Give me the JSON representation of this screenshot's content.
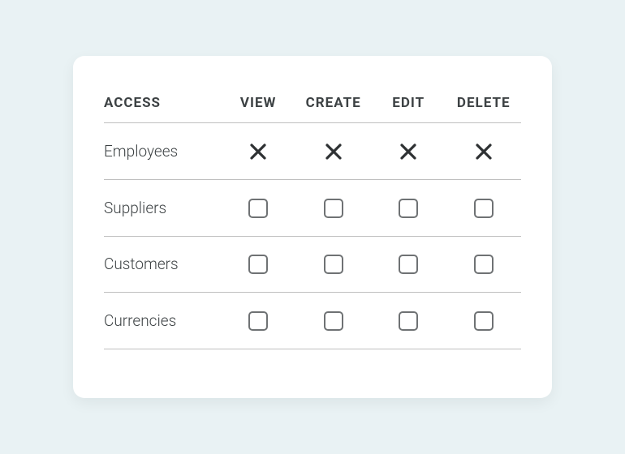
{
  "table": {
    "columns": [
      "ACCESS",
      "VIEW",
      "CREATE",
      "EDIT",
      "DELETE"
    ],
    "rows": [
      {
        "label": "Employees",
        "cells": [
          "x",
          "x",
          "x",
          "x"
        ]
      },
      {
        "label": "Suppliers",
        "cells": [
          "checkbox",
          "checkbox",
          "checkbox",
          "checkbox"
        ]
      },
      {
        "label": "Customers",
        "cells": [
          "checkbox",
          "checkbox",
          "checkbox",
          "checkbox"
        ]
      },
      {
        "label": "Currencies",
        "cells": [
          "checkbox",
          "checkbox",
          "checkbox",
          "checkbox"
        ]
      }
    ]
  }
}
